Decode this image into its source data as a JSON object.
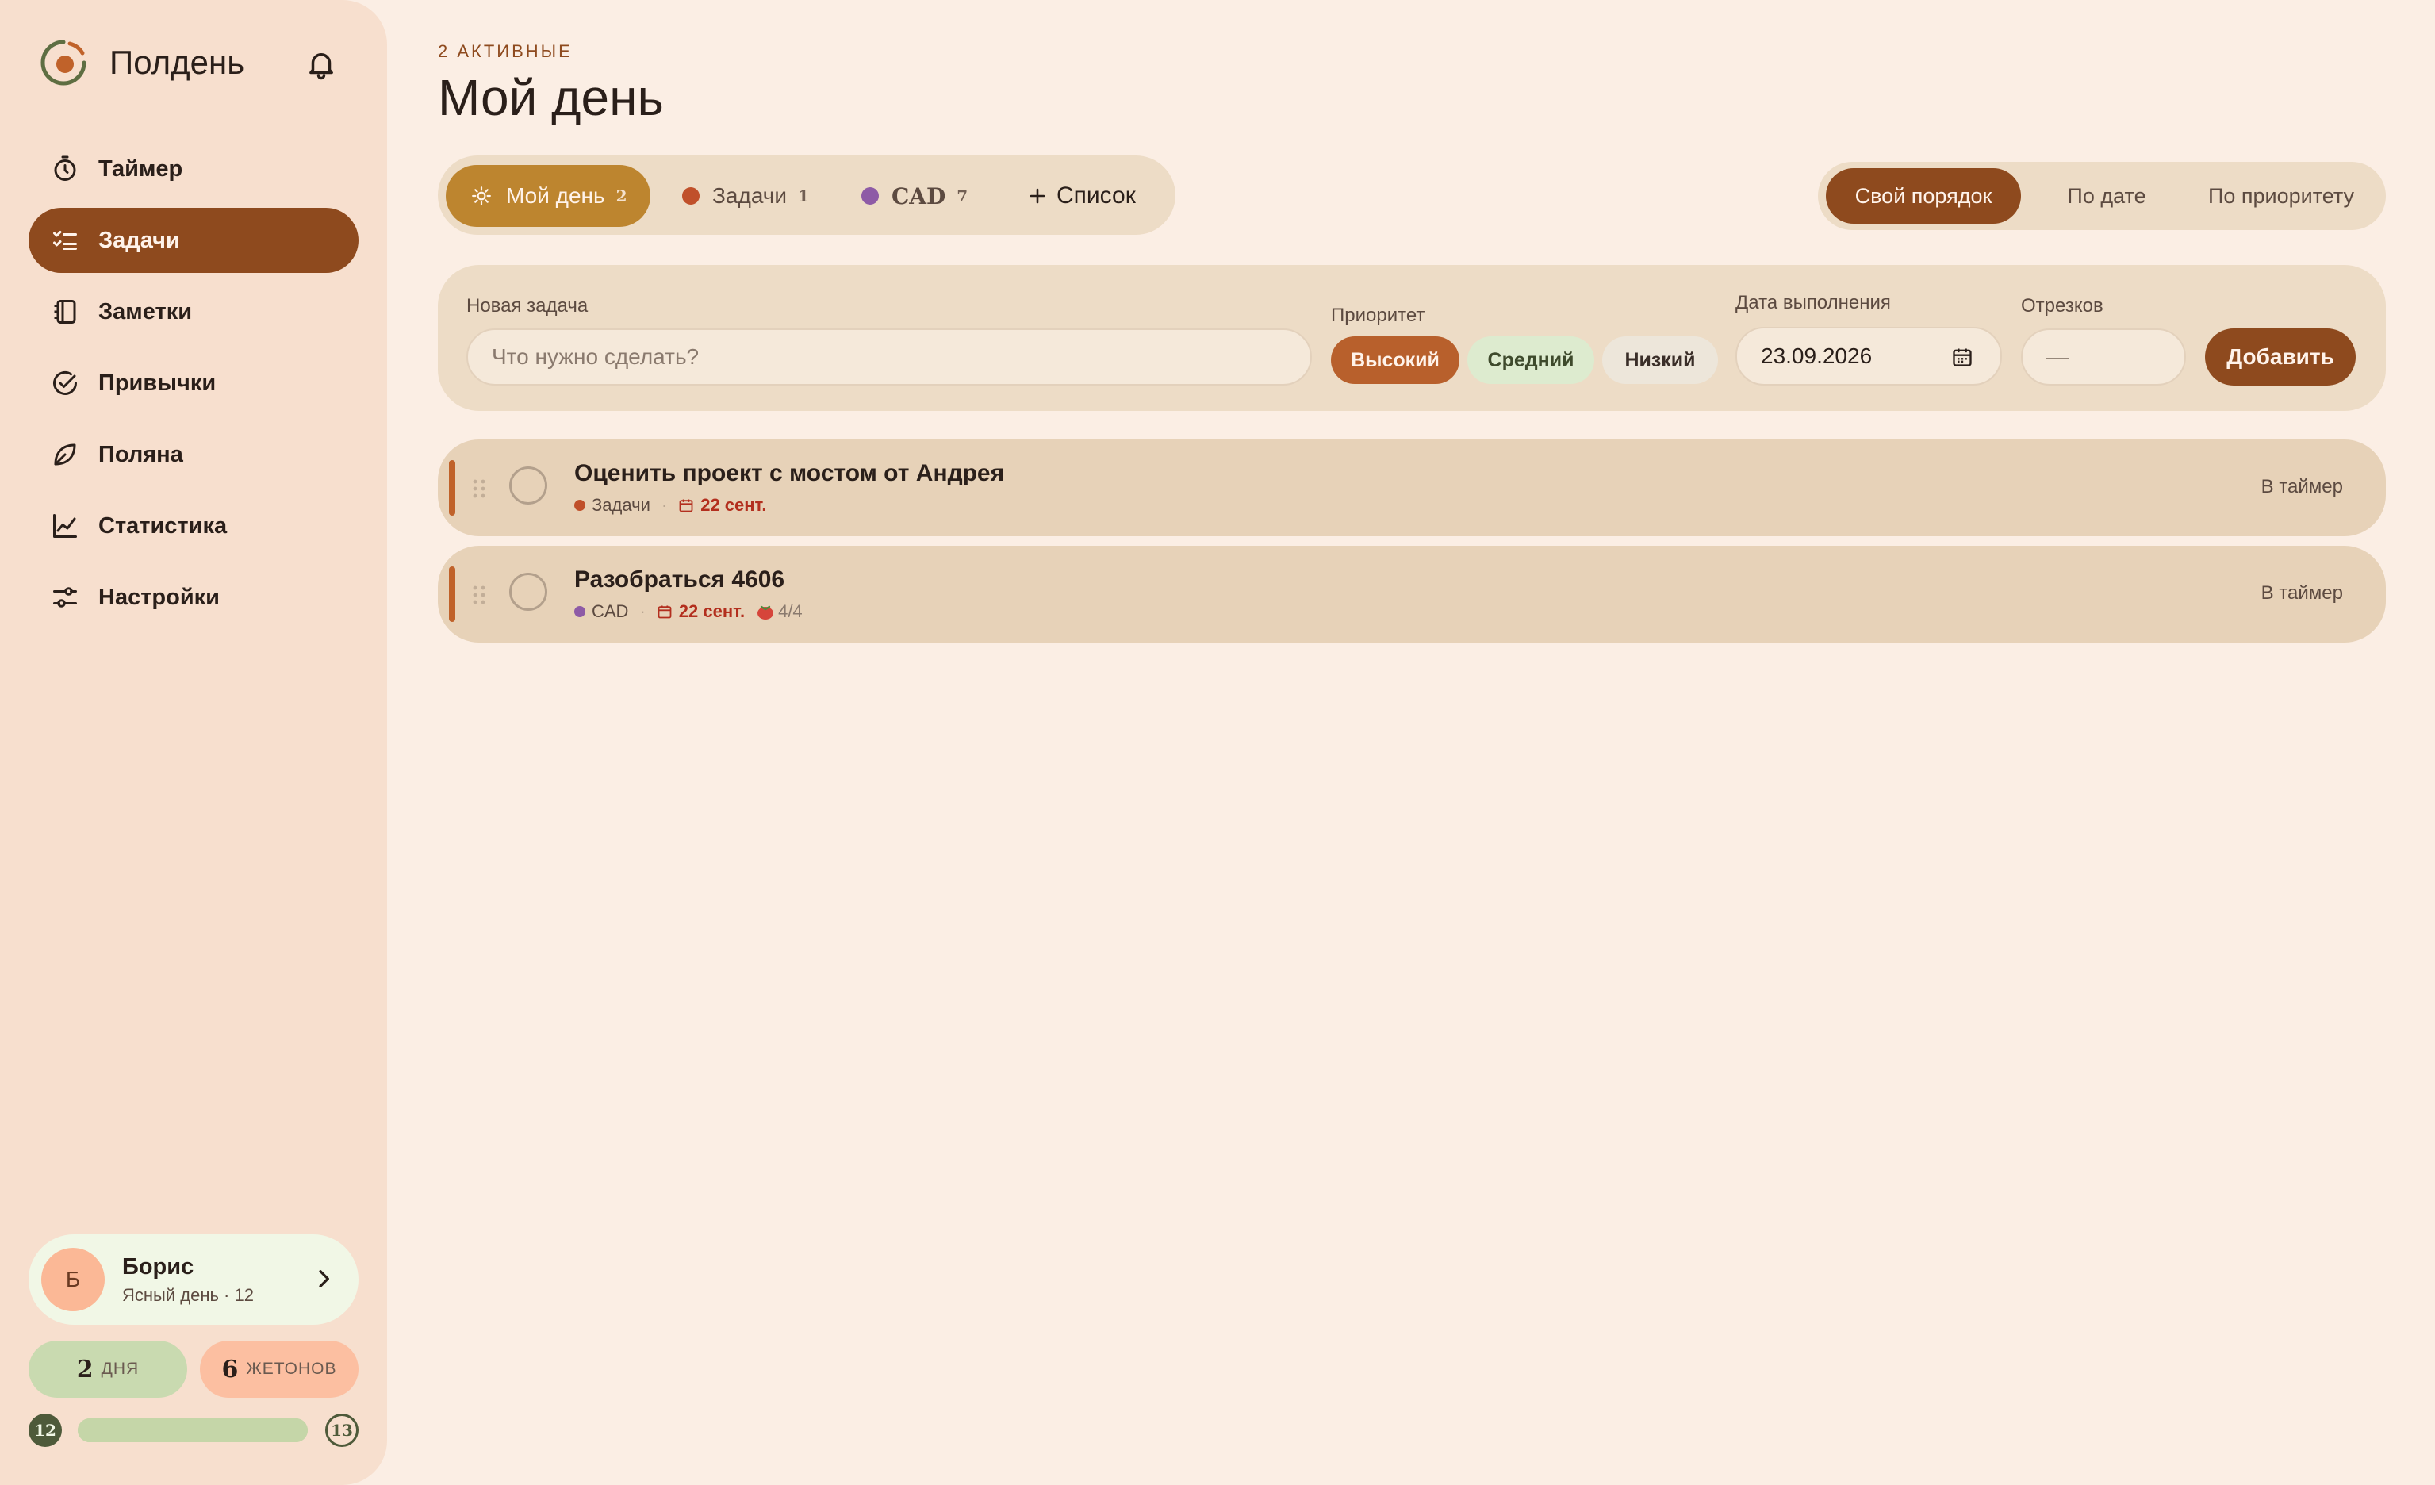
{
  "app": {
    "name": "Полдень"
  },
  "sidebar": {
    "items": [
      {
        "label": "Таймер",
        "icon": "timer-icon",
        "active": false
      },
      {
        "label": "Задачи",
        "icon": "tasks-icon",
        "active": true
      },
      {
        "label": "Заметки",
        "icon": "notes-icon",
        "active": false
      },
      {
        "label": "Привычки",
        "icon": "habits-icon",
        "active": false
      },
      {
        "label": "Поляна",
        "icon": "leaf-icon",
        "active": false
      },
      {
        "label": "Статистика",
        "icon": "chart-icon",
        "active": false
      },
      {
        "label": "Настройки",
        "icon": "settings-icon",
        "active": false
      }
    ],
    "user": {
      "initial": "Б",
      "name": "Борис",
      "subtitle": "Ясный день · 12"
    },
    "stats": {
      "days_value": "2",
      "days_label": "ДНЯ",
      "tokens_value": "6",
      "tokens_label": "ЖЕТОНОВ"
    },
    "level": {
      "current": "12",
      "next": "13",
      "progress": 1.0
    }
  },
  "header": {
    "kicker": "2 активные",
    "title": "Мой день"
  },
  "lists": [
    {
      "label": "Мой день",
      "count": "2",
      "active": true,
      "icon": "sun-icon"
    },
    {
      "label": "Задачи",
      "count": "1",
      "active": false,
      "color": "#C0502A"
    },
    {
      "label": "CAD",
      "count": "7",
      "active": false,
      "color": "#8E5BA6"
    },
    {
      "label": "Список",
      "icon": "plus-icon"
    }
  ],
  "sort": {
    "options": [
      "Свой порядок",
      "По дате",
      "По приоритету"
    ],
    "selected": "Свой порядок"
  },
  "new_task": {
    "label": "Новая задача",
    "placeholder": "Что нужно сделать?",
    "priority_label": "Приоритет",
    "priorities": [
      "Высокий",
      "Средний",
      "Низкий"
    ],
    "priority_selected": "Высокий",
    "due_label": "Дата выполнения",
    "due_value": "23.09.2026",
    "segments_label": "Отрезков",
    "segments_value": "—",
    "add_label": "Добавить"
  },
  "tasks": [
    {
      "title": "Оценить проект с мостом от Андрея",
      "list": "Задачи",
      "list_color": "#C0502A",
      "due": "22 сент.",
      "pomodoros": "",
      "to_timer": "В таймер"
    },
    {
      "title": "Разобраться 4606",
      "list": "CAD",
      "list_color": "#8E5BA6",
      "due": "22 сент.",
      "pomodoros": "4/4",
      "to_timer": "В таймер"
    }
  ],
  "colors": {
    "accent": "#8E4A1E",
    "my_day": "#BD852F",
    "high": "#B8602C",
    "medium": "#DDEBCF",
    "low": "#EDE6DA",
    "overdue": "#B32F1E"
  }
}
